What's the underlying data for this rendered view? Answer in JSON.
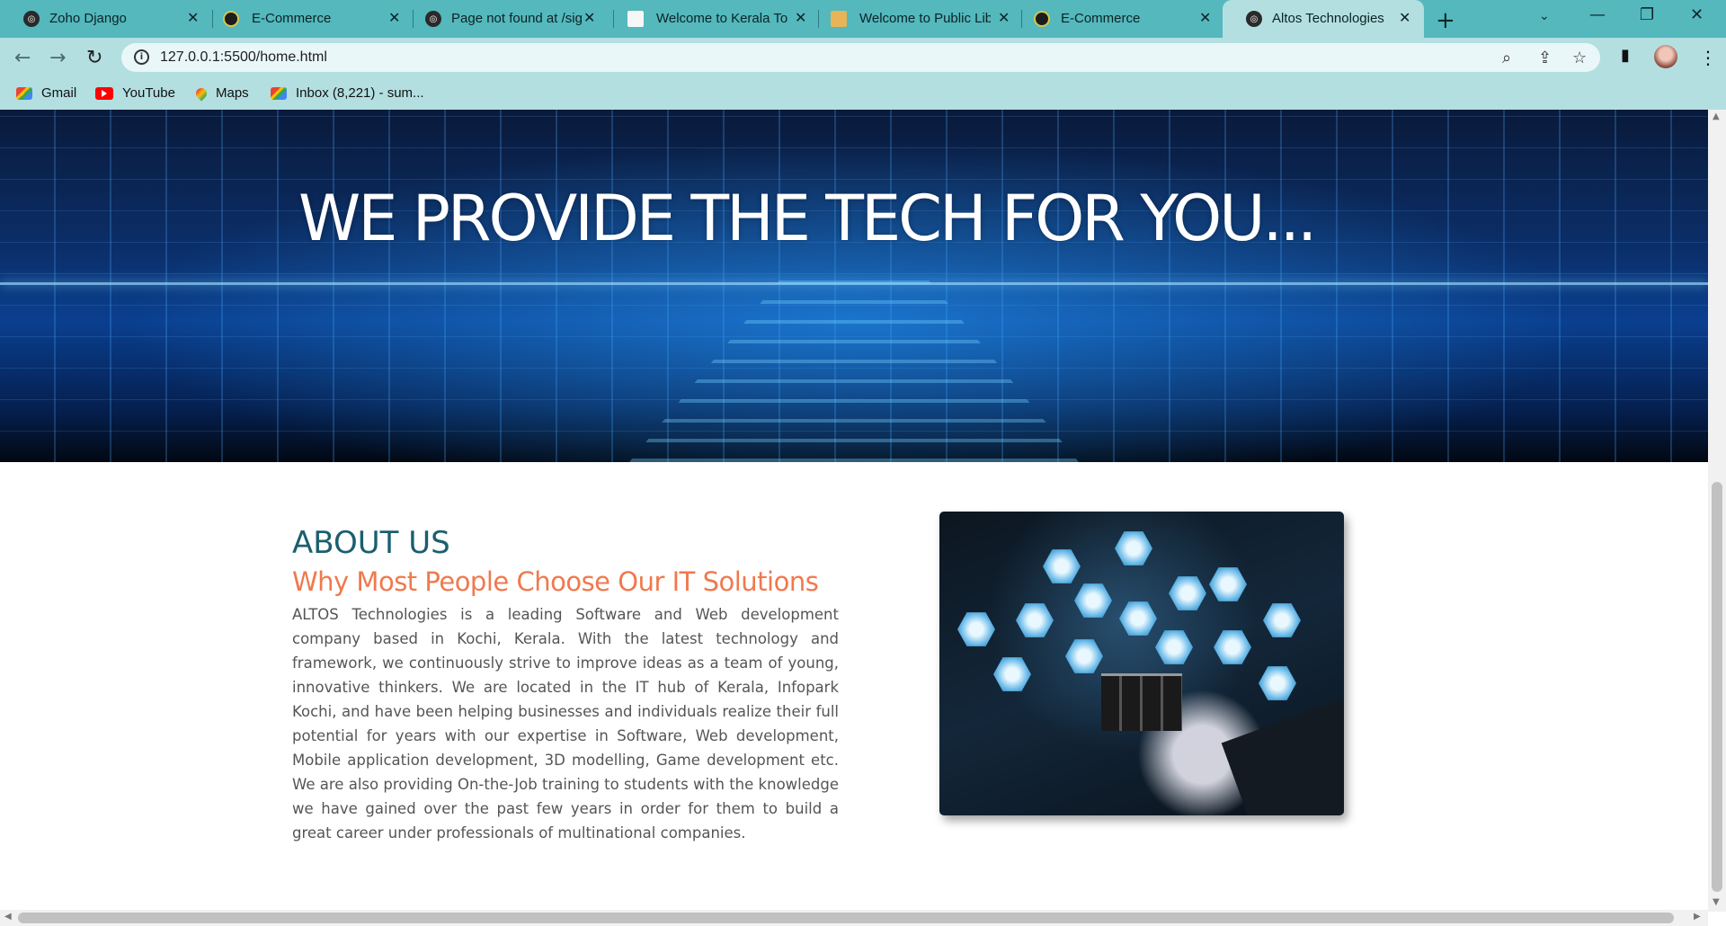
{
  "browser": {
    "tabs": [
      {
        "title": "Zoho Django",
        "icon": "globe-icon"
      },
      {
        "title": "E-Commerce",
        "icon": "ecommerce-icon"
      },
      {
        "title": "Page not found at /sig",
        "icon": "globe-icon"
      },
      {
        "title": "Welcome to Kerala To",
        "icon": "page-icon"
      },
      {
        "title": "Welcome to Public Lib",
        "icon": "book-icon"
      },
      {
        "title": "E-Commerce",
        "icon": "ecommerce-icon"
      },
      {
        "title": "Altos Technologies",
        "icon": "globe-icon",
        "active": true
      }
    ],
    "url": "127.0.0.1:5500/home.html",
    "bookmarks": [
      {
        "label": "Gmail",
        "icon": "gmail-icon"
      },
      {
        "label": "YouTube",
        "icon": "youtube-icon"
      },
      {
        "label": "Maps",
        "icon": "maps-icon"
      },
      {
        "label": "Inbox (8,221) - sum...",
        "icon": "gmail-icon"
      }
    ]
  },
  "hero": {
    "title": "WE PROVIDE THE TECH FOR YOU..."
  },
  "about": {
    "heading": "ABOUT US",
    "subheading": "Why Most People Choose Our IT Solutions",
    "body": "ALTOS Technologies is a leading Software and Web development company based in Kochi, Kerala. With the latest technology and framework, we continuously strive to improve ideas as a team of young, innovative thinkers. We are located in the IT hub of Kerala, Infopark Kochi, and have been helping businesses and individuals realize their full potential for years with our expertise in Software, Web development, Mobile application development, 3D modelling, Game development etc. We are also providing On-the-Job training to students with the knowledge we have gained over the past few years in order for them to build a great career under professionals of multinational companies."
  },
  "colors": {
    "tab_strip": "#54b8bd",
    "toolbar": "#b3dfe1",
    "about_heading": "#1b5f6e",
    "about_subheading": "#f0794d"
  }
}
